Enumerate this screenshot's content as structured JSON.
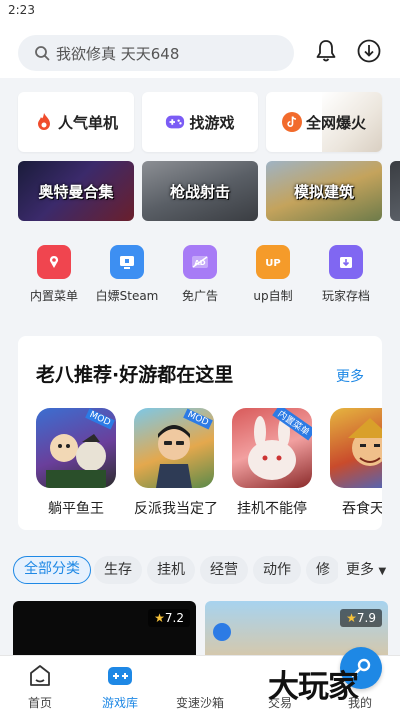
{
  "status_bar": {
    "time": "2:23"
  },
  "search": {
    "placeholder": "我欲修真 天天648"
  },
  "categories": [
    {
      "label": "人气单机",
      "icon": "fire-icon",
      "color": "#f04c2c"
    },
    {
      "label": "找游戏",
      "icon": "gamepad-icon",
      "color": "#7b5cf5"
    },
    {
      "label": "全网爆火",
      "icon": "douyin-icon",
      "color": "#f26b2c"
    }
  ],
  "banners": [
    {
      "label": "奥特曼合集"
    },
    {
      "label": "枪战射击"
    },
    {
      "label": "模拟建筑"
    },
    {
      "label": ""
    }
  ],
  "tools": [
    {
      "label": "内置菜单",
      "icon": "menu-icon",
      "color": "#f0454f"
    },
    {
      "label": "白嫖Steam",
      "icon": "monitor-icon",
      "color": "#3d8ff2"
    },
    {
      "label": "免广告",
      "icon": "ad-free-icon",
      "color": "#a77bf6"
    },
    {
      "label": "up自制",
      "icon": "up-icon",
      "color": "#f59b2a"
    },
    {
      "label": "玩家存档",
      "icon": "save-icon",
      "color": "#8067f2"
    }
  ],
  "recommend": {
    "title": "老八推荐·好游都在这里",
    "more": "更多",
    "games": [
      {
        "name": "躺平鱼王",
        "badge": "MOD"
      },
      {
        "name": "反派我当定了",
        "badge": "MOD"
      },
      {
        "name": "挂机不能停",
        "badge": "内置菜单"
      },
      {
        "name": "吞食天地",
        "badge": ""
      }
    ]
  },
  "filters": {
    "chips": [
      "全部分类",
      "生存",
      "挂机",
      "经营",
      "动作",
      "修"
    ],
    "more": "更多"
  },
  "cards": [
    {
      "rating": "7.2"
    },
    {
      "rating": "7.9"
    }
  ],
  "bottom_nav": {
    "items": [
      "首页",
      "游戏库",
      "变速沙箱",
      "交易",
      "我的"
    ],
    "watermark": "大玩家"
  },
  "colors": {
    "accent": "#1e88e5",
    "background": "#f2f4f7"
  }
}
